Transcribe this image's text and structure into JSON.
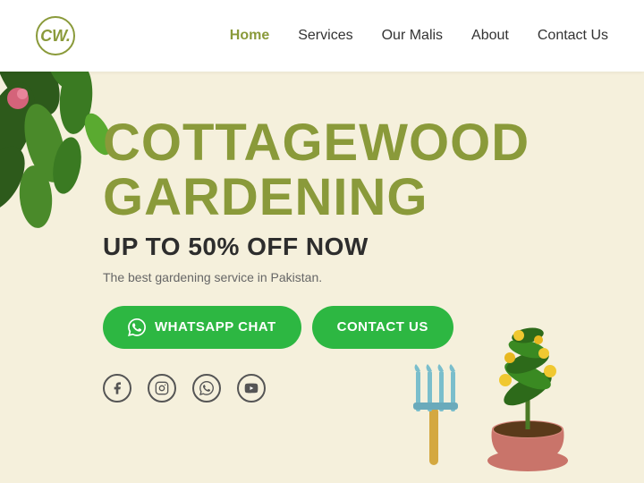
{
  "navbar": {
    "logo_text": "CW.",
    "links": [
      {
        "label": "Home",
        "active": true
      },
      {
        "label": "Services",
        "active": false
      },
      {
        "label": "Our Malis",
        "active": false
      },
      {
        "label": "About",
        "active": false
      },
      {
        "label": "Contact Us",
        "active": false
      }
    ]
  },
  "hero": {
    "title_line1": "COTTAGEWOOD",
    "title_line2": "GARDENING",
    "subtitle": "UP TO 50% OFF NOW",
    "description": "The best gardening service in Pakistan.",
    "btn_whatsapp": "WHATSAPP CHAT",
    "btn_contact": "CONTACT US"
  },
  "social": {
    "icons": [
      "facebook",
      "instagram",
      "whatsapp",
      "youtube"
    ]
  },
  "colors": {
    "accent_green": "#8a9a3a",
    "btn_green": "#2db742",
    "bg": "#f5f0dc"
  }
}
